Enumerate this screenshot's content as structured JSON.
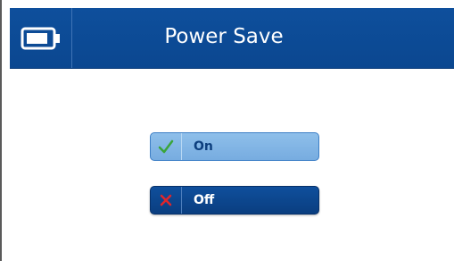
{
  "header": {
    "title": "Power Save",
    "icon": "battery-icon"
  },
  "options": [
    {
      "label": "On",
      "icon": "checkmark-icon",
      "icon_color": "#3aa53a",
      "selected": true
    },
    {
      "label": "Off",
      "icon": "x-icon",
      "icon_color": "#e0262b",
      "selected": false
    }
  ],
  "colors": {
    "header_bg": "#0e4f9c",
    "on_bg": "#84b6e6",
    "off_bg": "#0c4589"
  }
}
